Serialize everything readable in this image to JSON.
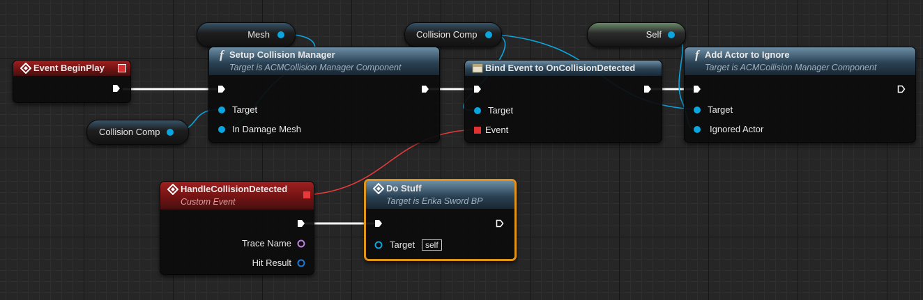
{
  "colors": {
    "exec_wire": "#ffffff",
    "object_wire": "#0aa6e0",
    "delegate_wire": "#e33b3b",
    "selection": "#e09418"
  },
  "nodes": {
    "begin_play": {
      "title": "Event BeginPlay",
      "icon": "event-diamond-icon"
    },
    "setup": {
      "title": "Setup Collision Manager",
      "subtitle": "Target is ACMCollision Manager Component",
      "pins": {
        "target": "Target",
        "damage_mesh": "In Damage Mesh"
      },
      "icon": "function-icon"
    },
    "bind": {
      "title": "Bind Event to OnCollisionDetected",
      "pins": {
        "target": "Target",
        "event": "Event"
      },
      "icon": "bind-event-icon"
    },
    "add_actor": {
      "title": "Add Actor to Ignore",
      "subtitle": "Target is ACMCollision Manager Component",
      "pins": {
        "target": "Target",
        "ignored": "Ignored Actor"
      },
      "icon": "function-icon"
    },
    "handle": {
      "title": "HandleCollisionDetected",
      "subtitle": "Custom Event",
      "pins": {
        "trace": "Trace Name",
        "hit": "Hit Result"
      },
      "icon": "event-diamond-icon"
    },
    "do_stuff": {
      "title": "Do Stuff",
      "subtitle": "Target is Erika Sword BP",
      "pins": {
        "target": "Target",
        "self_default": "self"
      },
      "icon": "event-diamond-icon"
    }
  },
  "variables": {
    "mesh": "Mesh",
    "collision_comp_top": "Collision Comp",
    "self": "Self",
    "collision_comp_left": "Collision Comp"
  }
}
